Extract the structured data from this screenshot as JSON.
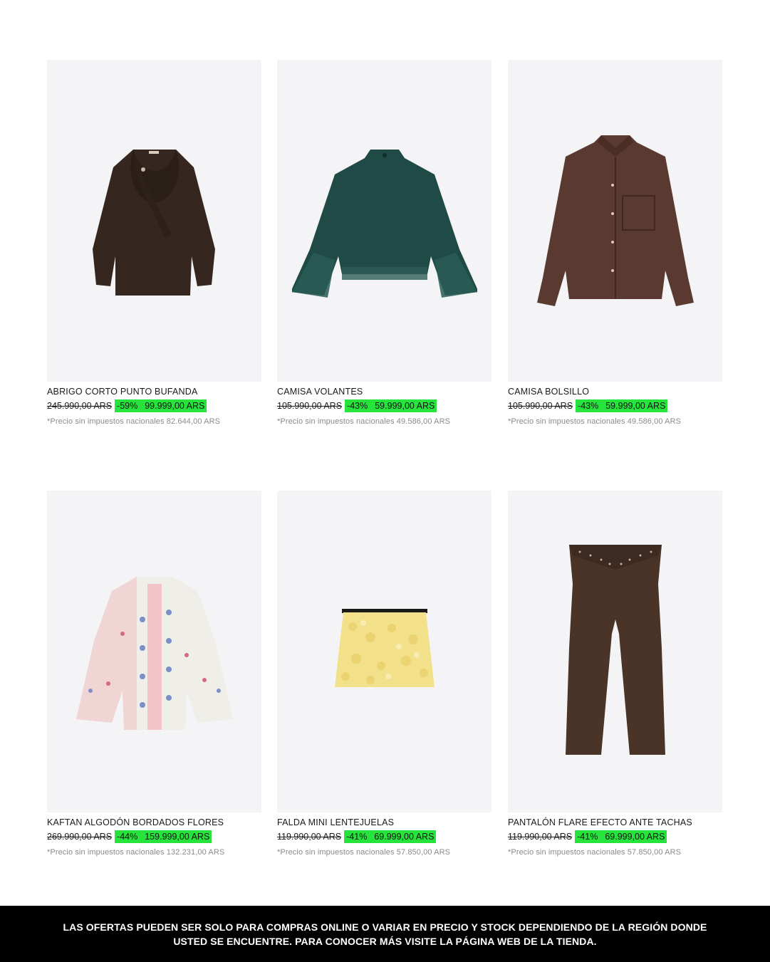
{
  "products": [
    {
      "name": "ABRIGO CORTO PUNTO BUFANDA",
      "old_price": "245.990,00 ARS",
      "discount": "-59%",
      "new_price": "99.999,00 ARS",
      "tax_note": "*Precio sin impuestos nacionales 82.644,00 ARS",
      "image_icon": "brown-knit-coat-icon",
      "color": "#3a2a22"
    },
    {
      "name": "CAMISA VOLANTES",
      "old_price": "105.990,00 ARS",
      "discount": "-43%",
      "new_price": "59.999,00 ARS",
      "tax_note": "*Precio sin impuestos nacionales 49.586,00 ARS",
      "image_icon": "green-ruffle-blouse-icon",
      "color": "#1f4a45"
    },
    {
      "name": "CAMISA BOLSILLO",
      "old_price": "105.990,00 ARS",
      "discount": "-43%",
      "new_price": "59.999,00 ARS",
      "tax_note": "*Precio sin impuestos nacionales 49.586,00 ARS",
      "image_icon": "brown-pocket-shirt-icon",
      "color": "#5a3a30"
    },
    {
      "name": "KAFTAN ALGODÓN BORDADOS FLORES",
      "old_price": "269.990,00 ARS",
      "discount": "-44%",
      "new_price": "159.999,00 ARS",
      "tax_note": "*Precio sin impuestos nacionales 132.231,00 ARS",
      "image_icon": "embroidered-kaftan-icon",
      "color": "#f2c4c8"
    },
    {
      "name": "FALDA MINI LENTEJUELAS",
      "old_price": "119.990,00 ARS",
      "discount": "-41%",
      "new_price": "69.999,00 ARS",
      "tax_note": "*Precio sin impuestos nacionales 57.850,00 ARS",
      "image_icon": "sequin-mini-skirt-icon",
      "color": "#f2e08a"
    },
    {
      "name": "PANTALÓN FLARE EFECTO ANTE TACHAS",
      "old_price": "119.990,00 ARS",
      "discount": "-41%",
      "new_price": "69.999,00 ARS",
      "tax_note": "*Precio sin impuestos nacionales 57.850,00 ARS",
      "image_icon": "suede-flare-pants-icon",
      "color": "#4a3428"
    }
  ],
  "footer": {
    "text": "LAS OFERTAS PUEDEN SER SOLO PARA COMPRAS ONLINE O VARIAR EN PRECIO Y STOCK DEPENDIENDO DE LA REGIÓN DONDE USTED SE ENCUENTRE. PARA CONOCER MÁS VISITE LA PÁGINA WEB DE LA TIENDA."
  },
  "colors": {
    "discount_highlight": "#27e43c",
    "image_bg": "#f4f4f6",
    "footer_bg": "#000000"
  }
}
